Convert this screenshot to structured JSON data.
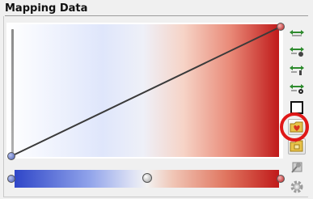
{
  "group": {
    "title": "Mapping Data"
  },
  "colors": {
    "low": "#2f46c8",
    "mid": "#f2f2f2",
    "high": "#c01a1a",
    "annotation": "#e01818"
  },
  "toolbar": {
    "buttons": [
      {
        "name": "linear-scale-button",
        "icon": "arrows-distribute-icon"
      },
      {
        "name": "log-scale-button",
        "icon": "arrows-log-icon"
      },
      {
        "name": "scale-option-button",
        "icon": "arrows-scale-icon"
      },
      {
        "name": "scale-mode-button",
        "icon": "arrows-mode-icon"
      },
      {
        "name": "color-swatch-button",
        "icon": "color-swatch-icon"
      },
      {
        "name": "favorites-folder-button",
        "icon": "folder-heart-icon"
      },
      {
        "name": "save-preset-button",
        "icon": "folder-save-icon"
      },
      {
        "name": "reset-button",
        "icon": "wand-icon"
      },
      {
        "name": "settings-button",
        "icon": "gear-icon"
      }
    ]
  }
}
